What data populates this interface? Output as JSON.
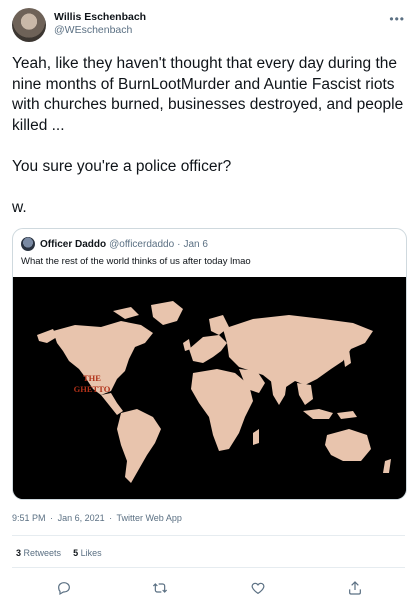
{
  "author": {
    "display_name": "Willis Eschenbach",
    "handle": "@WEschenbach"
  },
  "tweet": {
    "text": "Yeah, like they haven't thought that every day during the nine months of BurnLootMurder and Auntie Fascist riots with churches burned, businesses destroyed, and people killed ...\n\nYou sure you're a police officer?\n\nw."
  },
  "quoted": {
    "display_name": "Officer Daddo",
    "handle": "@officerdaddo",
    "separator": "·",
    "date": "Jan 6",
    "text": "What the rest of the world thinks of us after today lmao",
    "map_label_line1": "THE",
    "map_label_line2": "GHETTO"
  },
  "meta": {
    "time": "9:51 PM",
    "separator": "·",
    "date": "Jan 6, 2021",
    "source": "Twitter Web App"
  },
  "stats": {
    "retweets_count": "3",
    "retweets_label": "Retweets",
    "likes_count": "5",
    "likes_label": "Likes"
  },
  "icons": {
    "more": "more-icon",
    "reply": "reply-icon",
    "retweet": "retweet-icon",
    "like": "heart-icon",
    "share": "share-icon"
  },
  "colors": {
    "map_land": "#e8c4ad",
    "map_sea": "#000000",
    "map_label": "#b03018",
    "secondary_text": "#5b7083"
  }
}
